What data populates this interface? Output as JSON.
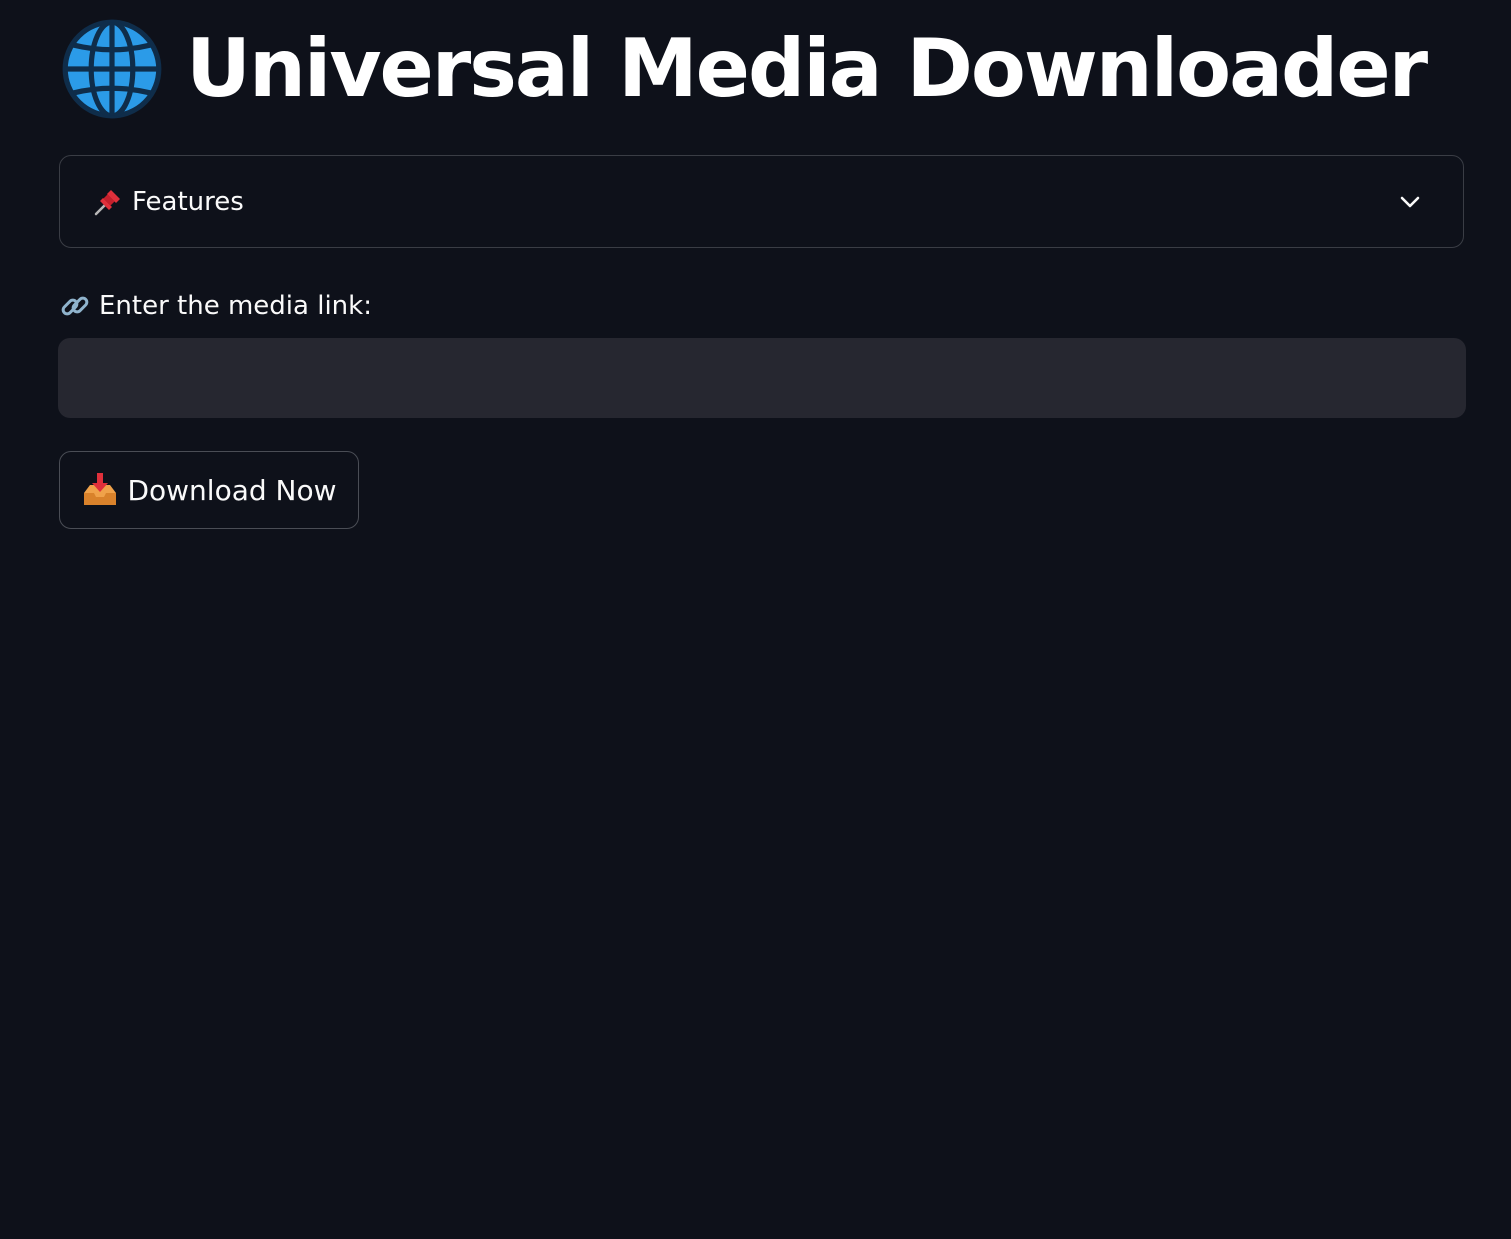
{
  "header": {
    "title": "Universal Media Downloader",
    "icon": "globe-icon"
  },
  "features_expander": {
    "label": "Features",
    "icon": "pushpin-icon",
    "toggle_icon": "chevron-down-icon",
    "expanded": false
  },
  "media_link": {
    "label": "Enter the media link:",
    "icon": "link-icon",
    "value": "",
    "placeholder": ""
  },
  "download_button": {
    "label": "Download Now",
    "icon": "inbox-tray-icon"
  },
  "colors": {
    "background": "#0e111a",
    "input_background": "#262730",
    "border": "#3a3d45",
    "text": "#fafafa",
    "globe_blue": "#2b9be8"
  }
}
